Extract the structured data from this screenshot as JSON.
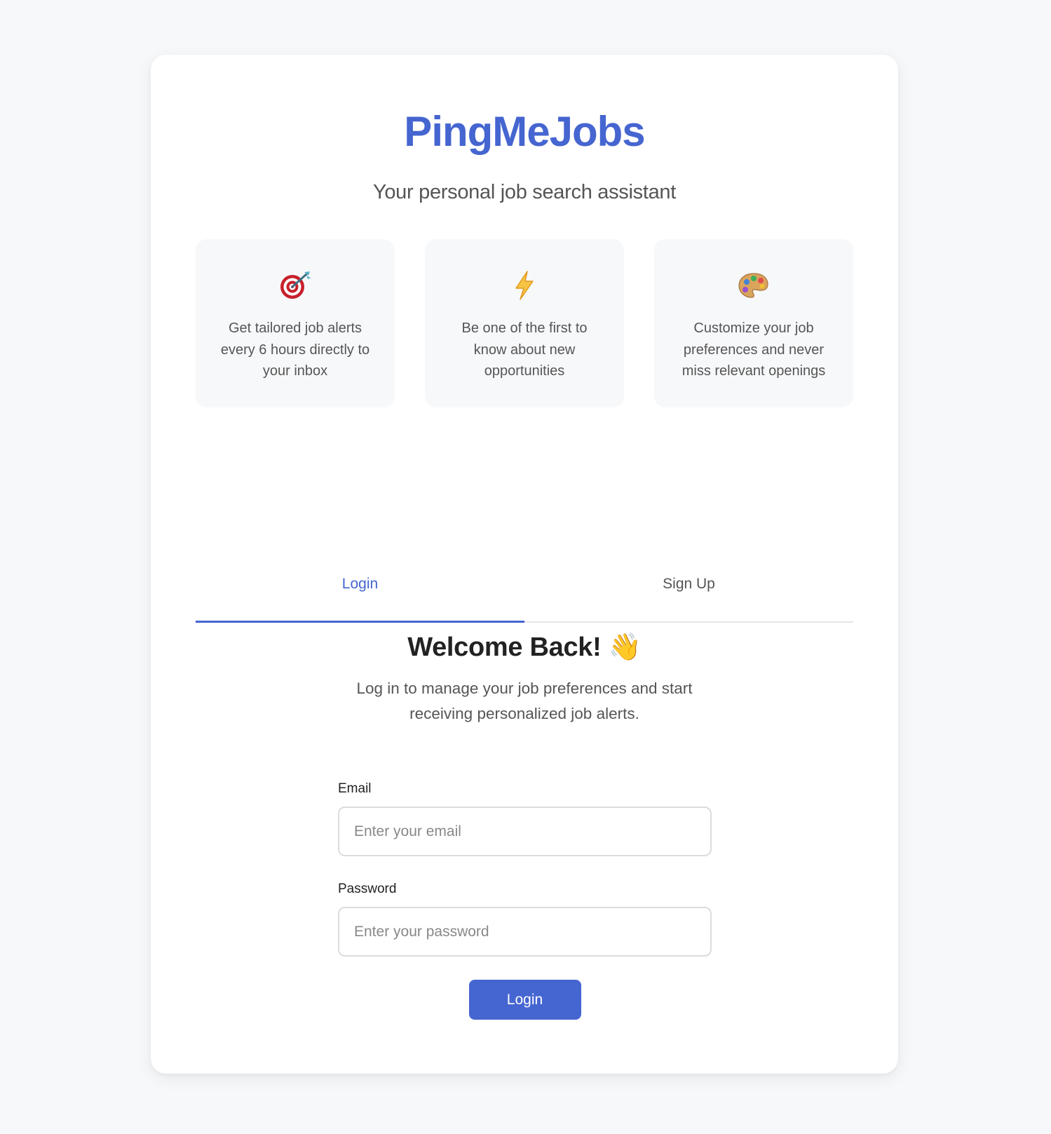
{
  "colors": {
    "accent": "#4565d0",
    "background": "#f7f8fa",
    "card": "#ffffff",
    "text_muted": "#555555",
    "text_dark": "#222222"
  },
  "header": {
    "brand": "PingMeJobs",
    "tagline": "Your personal job search assistant"
  },
  "features": [
    {
      "icon": "target-icon",
      "text": "Get tailored job alerts every 6 hours directly to your inbox"
    },
    {
      "icon": "lightning-icon",
      "text": "Be one of the first to know about new opportunities"
    },
    {
      "icon": "palette-icon",
      "text": "Customize your job preferences and never miss relevant openings"
    }
  ],
  "tabs": {
    "login": "Login",
    "signup": "Sign Up",
    "active": "login"
  },
  "login": {
    "title": "Welcome Back! 👋",
    "subtitle": "Log in to manage your job preferences and start receiving personalized job alerts.",
    "email_label": "Email",
    "email_placeholder": "Enter your email",
    "email_value": "",
    "password_label": "Password",
    "password_placeholder": "Enter your password",
    "password_value": "",
    "submit_label": "Login"
  }
}
